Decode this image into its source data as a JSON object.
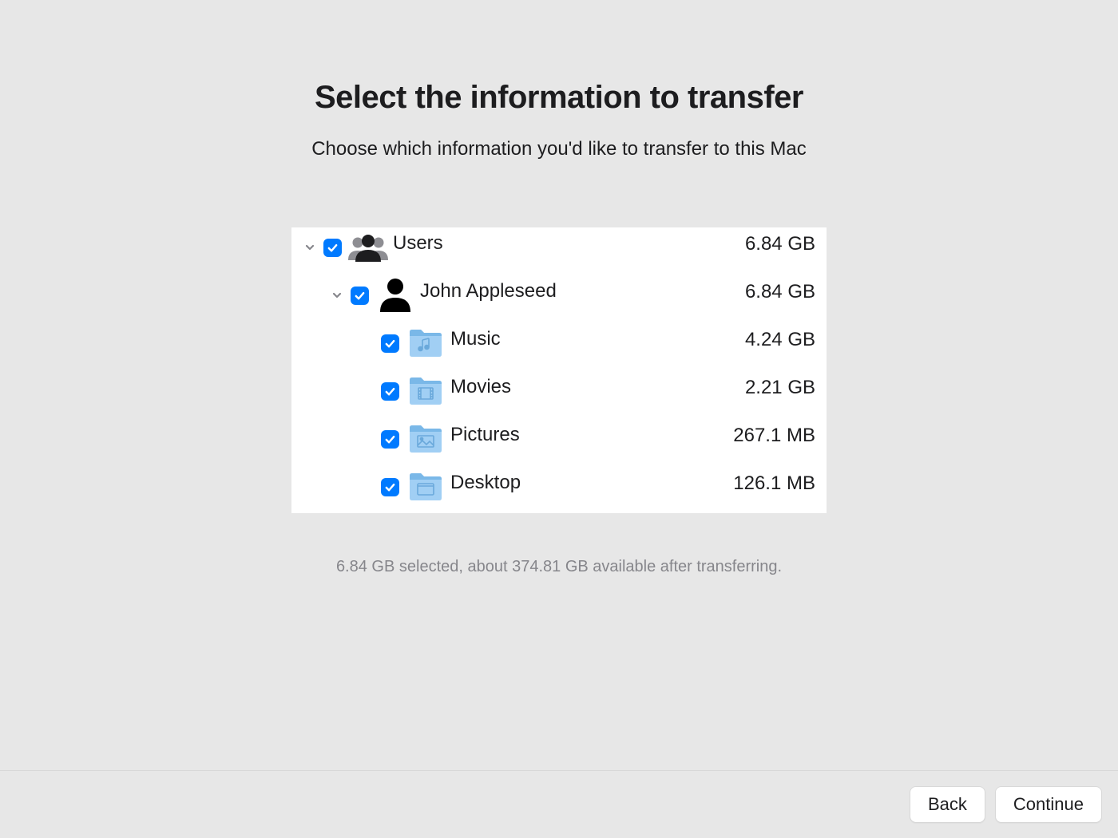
{
  "header": {
    "title": "Select the information to transfer",
    "subtitle": "Choose which information you'd like to transfer to this Mac"
  },
  "tree": {
    "users": {
      "label": "Users",
      "size": "6.84 GB",
      "checked": true,
      "expanded": true,
      "children": {
        "john": {
          "label": "John Appleseed",
          "size": "6.84 GB",
          "checked": true,
          "expanded": true,
          "items": [
            {
              "label": "Music",
              "size": "4.24 GB",
              "checked": true,
              "icon": "music"
            },
            {
              "label": "Movies",
              "size": "2.21 GB",
              "checked": true,
              "icon": "movies"
            },
            {
              "label": "Pictures",
              "size": "267.1 MB",
              "checked": true,
              "icon": "pictures"
            },
            {
              "label": "Desktop",
              "size": "126.1 MB",
              "checked": true,
              "icon": "desktop"
            }
          ]
        }
      }
    }
  },
  "status": "6.84 GB selected, about 374.81 GB available after transferring.",
  "footer": {
    "back_label": "Back",
    "continue_label": "Continue"
  },
  "colors": {
    "accent": "#007aff",
    "folder_fill": "#a1cff4",
    "folder_tab": "#7ab8e8"
  }
}
